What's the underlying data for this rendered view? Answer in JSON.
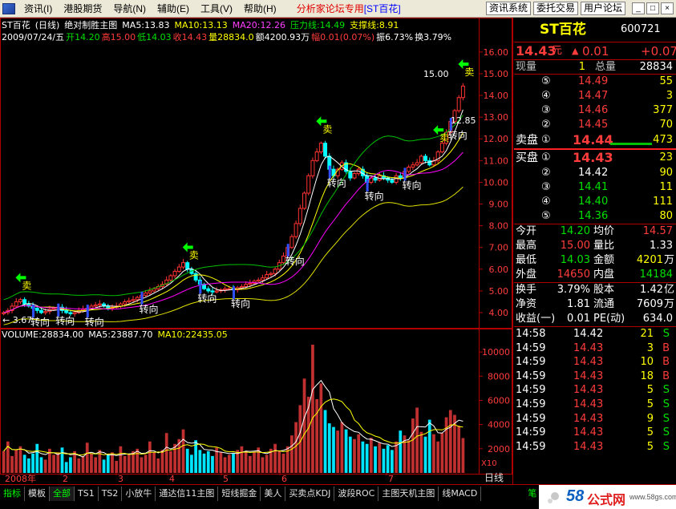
{
  "menu": {
    "items": [
      "资讯(I)",
      "港股期货",
      "导航(N)",
      "辅助(E)",
      "工具(V)",
      "帮助(H)"
    ],
    "title": "分析家论坛专用",
    "title_code": "[ST百花]",
    "buttons": [
      "资讯系统",
      "委托交易",
      "用户论坛"
    ],
    "win_controls": [
      "_",
      "□",
      "×"
    ]
  },
  "chart_header": {
    "line1": {
      "name": "ST百花",
      "period": "(日线)",
      "indicator": "绝对制胜主图",
      "ma5": "MA5:13.83",
      "ma10": "MA10:13.13",
      "ma20": "MA20:12.26",
      "pressure": "压力线:14.49",
      "support": "支撑线:8.91"
    },
    "line2": {
      "date": "2009/07/24/五",
      "open": "开14.20",
      "high": "高15.00",
      "low": "低14.03",
      "close": "收14.43",
      "volume": "量28834.0",
      "amount": "额4200.93万",
      "change": "幅0.01(0.07%)",
      "amplitude": "振6.73%",
      "turnover": "换3.79%"
    }
  },
  "volume_header": {
    "vol": "VOLUME:28834.00",
    "ma5": "MA5:23887.70",
    "ma10": "MA10:22435.05"
  },
  "chart_data": [
    {
      "type": "candlestick",
      "ylim": [
        3.3,
        16.4
      ],
      "y_ticks": [
        "16.00",
        "15.00",
        "14.00",
        "13.00",
        "12.00",
        "11.00",
        "10.00",
        "9.00",
        "8.00",
        "7.00",
        "6.00",
        "5.00",
        "4.00"
      ],
      "x_ticks": [
        "2008年",
        "2",
        "3",
        "4",
        "5",
        "6",
        "7"
      ],
      "annotations": [
        "卖",
        "卖",
        "卖",
        "卖",
        "卖",
        "转向",
        "转向",
        "转向",
        "转向",
        "转向",
        "转向",
        "转向",
        "转向",
        "转向",
        "转向",
        "转向"
      ],
      "price_marks": [
        "15.00",
        "← 3.67",
        "12.85"
      ],
      "series": [
        {
          "name": "MA5",
          "color": "#ffffff"
        },
        {
          "name": "MA10",
          "color": "#ffff00"
        },
        {
          "name": "MA20",
          "color": "#ff00ff"
        },
        {
          "name": "压力线",
          "color": "#00c000"
        },
        {
          "name": "支撑线",
          "color": "#e0e000"
        }
      ],
      "close": [
        4.0,
        4.1,
        4.3,
        4.5,
        4.6,
        4.4,
        4.3,
        4.2,
        4.1,
        4.0,
        4.05,
        4.15,
        4.2,
        4.25,
        4.1,
        4.0,
        3.95,
        4.0,
        4.1,
        4.15,
        4.2,
        4.3,
        4.35,
        4.4,
        4.3,
        4.2,
        4.25,
        4.3,
        4.4,
        4.5,
        4.55,
        4.6,
        4.7,
        4.8,
        4.9,
        5.0,
        5.1,
        5.2,
        5.3,
        5.5,
        5.7,
        5.9,
        6.1,
        6.3,
        6.0,
        5.8,
        5.5,
        5.3,
        5.1,
        5.0,
        4.95,
        5.0,
        5.05,
        5.1,
        5.1,
        5.05,
        5.15,
        5.2,
        5.3,
        5.35,
        5.45,
        5.5,
        5.6,
        5.75,
        5.8,
        6.0,
        6.3,
        6.6,
        7.0,
        7.5,
        8.1,
        8.8,
        9.5,
        10.3,
        11.0,
        11.4,
        11.8,
        11.2,
        10.6,
        10.3,
        10.6,
        10.9,
        10.5,
        10.2,
        10.4,
        10.6,
        10.3,
        10.0,
        10.2,
        10.1,
        10.3,
        10.2,
        10.1,
        10.0,
        10.3,
        10.2,
        10.5,
        10.7,
        10.8,
        10.9,
        11.2,
        11.0,
        10.8,
        11.0,
        11.4,
        11.8,
        12.3,
        12.8,
        13.3,
        13.9,
        14.43
      ]
    },
    {
      "type": "bar",
      "name": "VOLUME",
      "ylim": [
        0,
        11000
      ],
      "y_ticks": [
        "10000",
        "8000",
        "6000",
        "4000",
        "2000"
      ],
      "multiplier": "X10",
      "values": [
        1800,
        2600,
        1400,
        1900,
        2200,
        1500,
        1200,
        1600,
        2400,
        1300,
        1100,
        2000,
        1500,
        1700,
        2100,
        900,
        1300,
        1800,
        1200,
        1400,
        2500,
        1600,
        1300,
        1900,
        1100,
        1500,
        1700,
        1000,
        2200,
        1400,
        1600,
        1800,
        2000,
        1300,
        1500,
        2600,
        1700,
        1200,
        1900,
        3300,
        1800,
        2400,
        2800,
        3600,
        2000,
        1500,
        2700,
        1900,
        1600,
        1800,
        1400,
        2100,
        1700,
        1300,
        1500,
        1600,
        1900,
        2200,
        1800,
        1400,
        1700,
        2100,
        1300,
        1500,
        2000,
        2400,
        1800,
        1600,
        2200,
        3100,
        4200,
        5600,
        7800,
        6300,
        10600,
        6100,
        7400,
        5200,
        4100,
        3800,
        3500,
        4200,
        3600,
        3000,
        2800,
        3200,
        2600,
        2400,
        2900,
        2200,
        2500,
        2000,
        2300,
        1900,
        2600,
        3500,
        3100,
        2700,
        4500,
        5400,
        3400,
        3000,
        4400,
        3200,
        2600,
        3300,
        4600,
        5200,
        4800,
        3900,
        2883
      ]
    },
    {
      "type": "line",
      "name": "VOLUME MA5/MA10"
    }
  ],
  "right_panel": {
    "name": "ST百花",
    "code": "600721",
    "price": "14.43",
    "price_unit": "元",
    "change_arrow": "▲",
    "change": "0.01",
    "change2": "+0.07",
    "xianliang_label": "现量",
    "xianliang": "1",
    "zongliang_label": "总量",
    "zongliang": "28834",
    "sell_levels": [
      {
        "num": "⑤",
        "price": "14.49",
        "vol": "55"
      },
      {
        "num": "④",
        "price": "14.47",
        "vol": "3"
      },
      {
        "num": "③",
        "price": "14.46",
        "vol": "377"
      },
      {
        "num": "②",
        "price": "14.45",
        "vol": "70"
      },
      {
        "label": "卖盘",
        "num": "①",
        "price": "14.44",
        "vol": "473"
      }
    ],
    "buy_levels": [
      {
        "label": "买盘",
        "num": "①",
        "price": "14.43",
        "vol": "23"
      },
      {
        "num": "②",
        "price": "14.42",
        "vol": "90"
      },
      {
        "num": "③",
        "price": "14.41",
        "vol": "11"
      },
      {
        "num": "④",
        "price": "14.40",
        "vol": "111"
      },
      {
        "num": "⑤",
        "price": "14.36",
        "vol": "80"
      }
    ],
    "stats": [
      {
        "l1": "今开",
        "v1": "14.20",
        "l2": "均价",
        "v2": "14.57"
      },
      {
        "l1": "最高",
        "v1": "15.00",
        "l2": "量比",
        "v2": "1.33"
      },
      {
        "l1": "最低",
        "v1": "14.03",
        "l2": "金额",
        "v2": "4201",
        "u2": "万"
      },
      {
        "l1": "外盘",
        "v1": "14650",
        "l2": "内盘",
        "v2": "14184"
      }
    ],
    "fund": [
      {
        "l1": "换手",
        "v1": "3.79%",
        "l2": "股本",
        "v2": "1.42",
        "u2": "亿"
      },
      {
        "l1": "净资",
        "v1": "1.81",
        "l2": "流通",
        "v2": "7609",
        "u2": "万"
      },
      {
        "l1": "收益(一)",
        "v1": "0.01",
        "l2": "PE(动)",
        "v2": "634.0"
      }
    ],
    "ticks": [
      {
        "time": "14:58",
        "price": "14.42",
        "vol": "21",
        "bs": "S"
      },
      {
        "time": "14:59",
        "price": "14.43",
        "vol": "3",
        "bs": "B"
      },
      {
        "time": "14:59",
        "price": "14.43",
        "vol": "10",
        "bs": "B"
      },
      {
        "time": "14:59",
        "price": "14.43",
        "vol": "18",
        "bs": "B"
      },
      {
        "time": "14:59",
        "price": "14.43",
        "vol": "5",
        "bs": "S"
      },
      {
        "time": "14:59",
        "price": "14.43",
        "vol": "5",
        "bs": "S"
      },
      {
        "time": "14:59",
        "price": "14.43",
        "vol": "9",
        "bs": "S"
      },
      {
        "time": "14:59",
        "price": "14.43",
        "vol": "5",
        "bs": "S"
      },
      {
        "time": "14:59",
        "price": "14.43",
        "vol": "5",
        "bs": "S"
      }
    ]
  },
  "tabs": {
    "items": [
      "指标",
      "模板",
      "全部",
      "TS1",
      "TS2",
      "小放牛",
      "通达信11主图",
      "短线掘金",
      "美人",
      "买卖点KDJ",
      "波段ROC",
      "主图天机主图",
      "线MACD",
      "笔"
    ],
    "right_label": "日线"
  },
  "watermark": {
    "brand_num": "58",
    "brand_text": "公式网",
    "url": "www.58gs.com"
  }
}
